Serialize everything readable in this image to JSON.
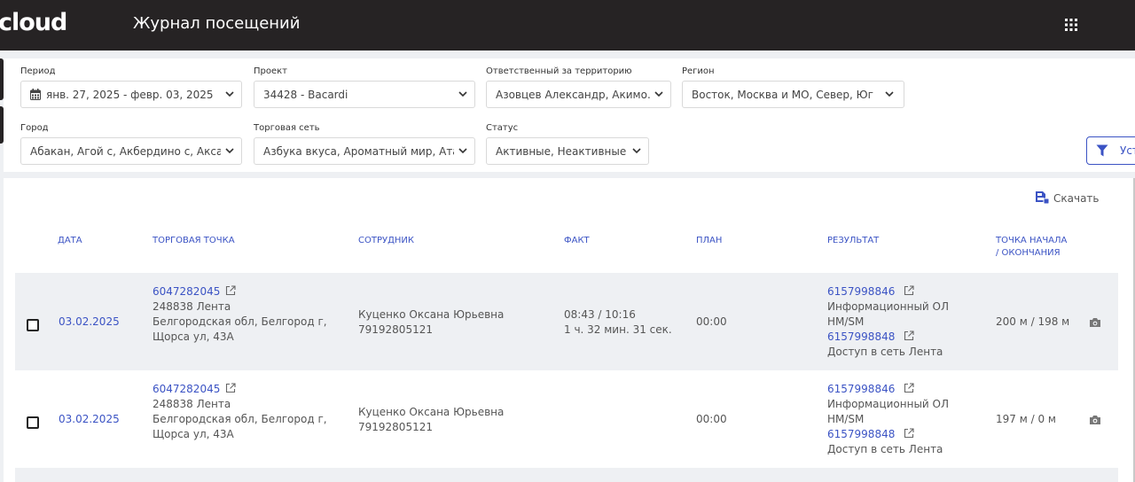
{
  "header": {
    "logo": "cloud",
    "title": "Журнал посещений"
  },
  "filters": {
    "period": {
      "label": "Период",
      "value": "янв. 27, 2025 - февр. 03, 2025"
    },
    "project": {
      "label": "Проект",
      "value": "34428 - Bacardi"
    },
    "responsible": {
      "label": "Ответственный за территорию",
      "value": "Азовцев Александр, Акимо..."
    },
    "region": {
      "label": "Регион",
      "value": "Восток, Москва и МО, Север, Юг"
    },
    "city": {
      "label": "Город",
      "value": "Абакан, Агой с, Акбердино с, Акса..."
    },
    "chain": {
      "label": "Торговая сеть",
      "value": "Азбука вкуса, Ароматный мир, Ата..."
    },
    "status": {
      "label": "Статус",
      "value": "Активные, Неактивные"
    },
    "apply_label": "Уст"
  },
  "toolbar": {
    "download_label": "Скачать"
  },
  "table": {
    "headers": {
      "date": "ДАТА",
      "outlet": "ТОРГОВАЯ ТОЧКА",
      "employee": "СОТРУДНИК",
      "fact": "ФАКТ",
      "plan": "ПЛАН",
      "result": "РЕЗУЛЬТАТ",
      "point_line1": "ТОЧКА НАЧАЛА",
      "point_line2": "/ ОКОНЧАНИЯ"
    },
    "rows": [
      {
        "date": "03.02.2025",
        "outlet_id": "6047282045",
        "outlet_line1": "248838 Лента",
        "outlet_line2": "Белгородская обл, Белгород г,",
        "outlet_line3": "Щорса ул, 43А",
        "employee_name": "Куценко Оксана Юрьевна",
        "employee_phone": "79192805121",
        "fact_time": "08:43 / 10:16",
        "fact_duration": "1 ч. 32 мин. 31 сек.",
        "plan": "00:00",
        "result1_id": "6157998846",
        "result1_line1": "Информационный ОЛ",
        "result1_line2": "HM/SM",
        "result2_id": "6157998848",
        "result2_line1": "Доступ в сеть Лента",
        "distance": "200 м / 198 м"
      },
      {
        "date": "03.02.2025",
        "outlet_id": "6047282045",
        "outlet_line1": "248838 Лента",
        "outlet_line2": "Белгородская обл, Белгород г,",
        "outlet_line3": "Щорса ул, 43А",
        "employee_name": "Куценко Оксана Юрьевна",
        "employee_phone": "79192805121",
        "fact_time": "",
        "fact_duration": "",
        "plan": "00:00",
        "result1_id": "6157998846",
        "result1_line1": "Информационный ОЛ",
        "result1_line2": "HM/SM",
        "result2_id": "6157998848",
        "result2_line1": "Доступ в сеть Лента",
        "distance": "197 м / 0 м"
      }
    ]
  },
  "colors": {
    "topbar": "#262324",
    "accent": "#3b53c4",
    "row_shade": "#eef0f3"
  }
}
